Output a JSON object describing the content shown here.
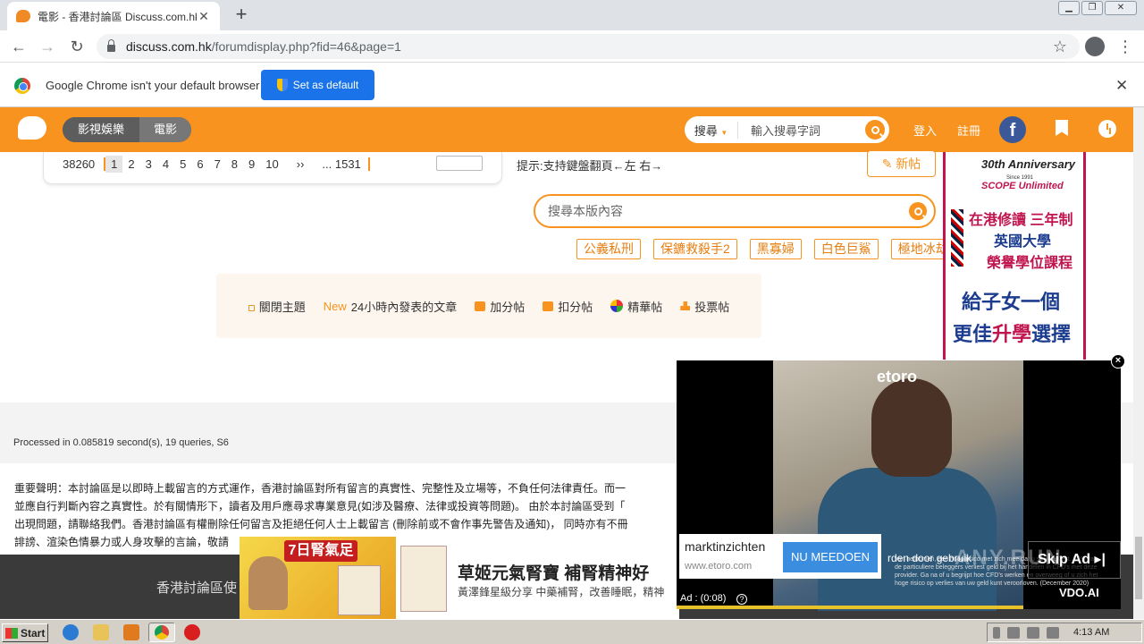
{
  "browser": {
    "tab_title": "電影 - 香港討論區 Discuss.com.hk -",
    "new_tab": "+",
    "url_host": "discuss.com.hk",
    "url_path": "/forumdisplay.php?fid=46&page=1",
    "infobar_text": "Google Chrome isn't your default browser",
    "set_default_label": "Set as default",
    "close_glyph": "✕"
  },
  "header": {
    "nav": [
      "影視娛樂",
      "電影"
    ],
    "search_select": "搜尋",
    "search_placeholder": "輸入搜尋字詞",
    "login": "登入",
    "register": "註冊",
    "facebook": "f"
  },
  "pagination": {
    "total": "38260",
    "pages": [
      "1",
      "2",
      "3",
      "4",
      "5",
      "6",
      "7",
      "8",
      "9",
      "10"
    ],
    "next": "››",
    "last": "... 1531",
    "hint": "提示:支持鍵盤翻頁←左 右→"
  },
  "new_post_label": "✎ 新帖",
  "board_search_placeholder": "搜尋本版內容",
  "tags": [
    "公義私刑",
    "保鑣救殺手2",
    "黑寡婦",
    "白色巨鯊",
    "極地冰劫"
  ],
  "filters": {
    "closed": "關閉主題",
    "new_prefix": "New",
    "new_24h": "24小時內發表的文章",
    "plus": "加分帖",
    "minus": "扣分帖",
    "digest": "精華帖",
    "poll": "投票帖"
  },
  "side_ad": {
    "anniversary": "30th Anniversary",
    "since": "Since 1991",
    "scope": "SCOPE Unlimited",
    "line1": "在港修讀 三年制",
    "line2": "英國大學",
    "line3": "榮譽學位課程",
    "line4": "給子女一個",
    "line5a": "更佳",
    "line5b": "升學",
    "line5c": "選擇"
  },
  "processed_text": "Processed in 0.085819 second(s), 19 queries, S6",
  "disclaimer_lines": [
    "重要聲明：本討論區是以即時上載留言的方式運作，香港討論區對所有留言的真實性、完整性及立場等，不負任何法律責任。而一",
    "並應自行判斷內容之真實性。於有關情形下，讀者及用戶應尋求專業意見(如涉及醫療、法律或投資等問題)。 由於本討論區受到「",
    "出現問題，請聯絡我們。香港討論區有權刪除任何留言及拒絕任何人士上載留言 (刪除前或不會作事先警告及通知)， 同時亦有不冊",
    "誹謗、渲染色情暴力或人身攻擊的言論，敬請"
  ],
  "footer_text": "香港討論區使",
  "bottom_ad": {
    "badge": "7日腎氣足",
    "headline": "草姬元氣腎寶 補腎精神好",
    "sub": "黃澤鋒星級分享 中藥補腎，改善睡眠，精神"
  },
  "video_ad": {
    "brand_logo": "etoro",
    "cta_brand": "marktinzichten",
    "cta_url": "www.etoro.com",
    "cta_button": "NU MEEDOEN",
    "overlay_text": "rden door gebruik",
    "small_print": "van hefbomen, een hoog risico met zich mee dat u snel verliest. 67% van de particuliere beleggers verliest geld bij het handelen in CFD's met deze provider. Ga na of u begrijpt hoe CFD's werken en overweeg of u zich het hoge risico op verlies van uw geld kunt veroorloven. (December 2020)",
    "timer": "Ad : (0:08)",
    "help": "?",
    "skip": "Skip Ad ▸|",
    "network": "VDO.AI",
    "close": "×",
    "progress": 0.78
  },
  "watermark": "ANY.RUN",
  "taskbar": {
    "start": "Start",
    "clock": "4:13 AM"
  }
}
